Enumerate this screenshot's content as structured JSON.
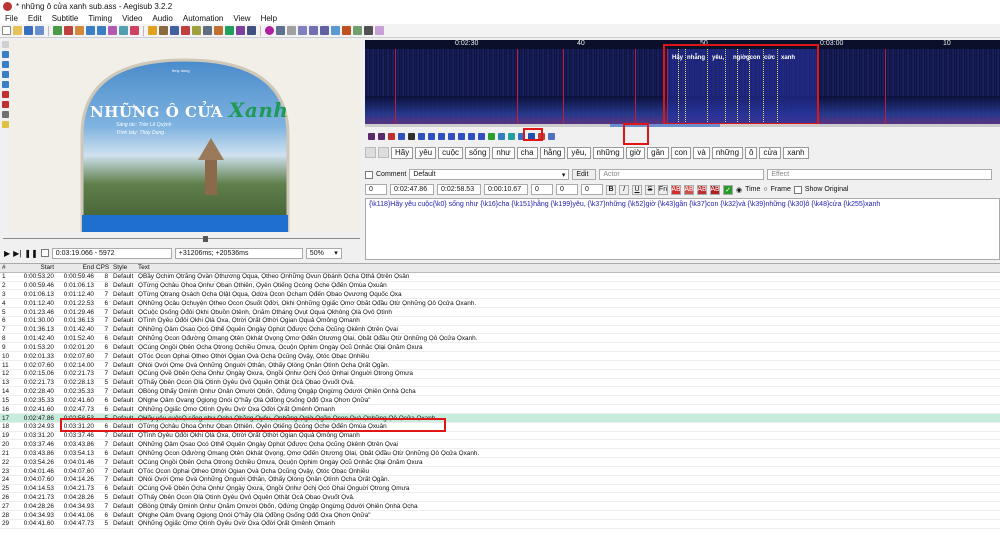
{
  "window": {
    "title": "* những ô cửa xanh sub.ass - Aegisub 3.2.2"
  },
  "menu": [
    "File",
    "Edit",
    "Subtitle",
    "Timing",
    "Video",
    "Audio",
    "Automation",
    "View",
    "Help"
  ],
  "video": {
    "title_main": "NHỮNG Ô CỬA",
    "title_accent": "Xanh",
    "composer": "Sáng tác: Trần Lê Quỳnh",
    "performer": "Trình bày: Thùy Dung",
    "logo": "thùy dung",
    "time": "0:03:19.066 - 5972",
    "offset": "+31206ms; +20536ms",
    "zoom": "50%"
  },
  "audio": {
    "ruler": [
      {
        "label": "0:02:30"
      },
      {
        "label": "40"
      },
      {
        "label": "50"
      },
      {
        "label": "0:03:00"
      },
      {
        "label": "10"
      }
    ],
    "words": [
      "Hãy",
      "nhẵng",
      "yêu,",
      "ngiờ",
      "gcon",
      "cửc",
      "xanh"
    ]
  },
  "karaoke": {
    "words": [
      "Hãy",
      "yêu",
      "cuộc",
      "sống",
      "như",
      "cha",
      "hằng",
      "yêu,",
      "những",
      "giờ",
      "gần",
      "con",
      "và",
      "những",
      "ô",
      "cửa",
      "xanh"
    ]
  },
  "edit": {
    "comment_label": "Comment",
    "style": "Default",
    "edit_label": "Edit",
    "actor_placeholder": "Actor",
    "effect_placeholder": "Effect",
    "layer": "0",
    "start": "0:02:47.86",
    "end": "0:02:58.53",
    "duration": "0:00:10.67",
    "margin_l": "0",
    "margin_r": "0",
    "margin_v": "0",
    "bold": "B",
    "italic": "I",
    "underline": "U",
    "strike": "S",
    "font": "Fn",
    "color1": "AB",
    "color2": "AB",
    "color3": "AB",
    "color4": "AB",
    "time_label": "Time",
    "frame_label": "Frame",
    "show_original": "Show Original",
    "text": "{\\k118}Hãy yêu cuộc{\\k0} sống như {\\k16}cha {\\k151}hằng {\\k199}yêu, {\\k37}những {\\k52}giờ {\\k43}gần {\\k37}con {\\k32}và {\\k39}những {\\k30}ô {\\k48}cửa {\\k255}xanh"
  },
  "grid": {
    "headers": [
      "#",
      "Start",
      "End",
      "CPS",
      "Style",
      "Text"
    ],
    "rows": [
      [
        "1",
        "0:00:53.20",
        "0:00:59.46",
        "8",
        "Default",
        "ỌBầy Ọchim Ọtrắng Ọvẫn Ọthương Ọqua, Ọtheo Ọnhững Ọvun Ọbánh Ọcha Ọthả Ọtrên Ọsân"
      ],
      [
        "2",
        "0:00:59.46",
        "0:01:06.13",
        "8",
        "Default",
        "ỌTừng Ọchâu Ọhoa Ọnhư Ọban Ọthiên, Ọyên Ọtiếng Ọcòng Ọche Ọđến Ọmùa Ọxuân"
      ],
      [
        "3",
        "0:01:06.13",
        "0:01:12.40",
        "7",
        "Default",
        "ỌTừng Ọtrang Ọsách Ọcha Ọlật Ọqua, Ọdừa Ọcon Ọchạm Ọđến Ọbao Ọvương Ọquốc Ọxa"
      ],
      [
        "4",
        "0:01:12.40",
        "0:01:22.53",
        "6",
        "Default",
        "ỌNhững Ọcâu Ọchuyện Ọtheo Ọcon Ọsuốt Ọđời, Ọkhi Ọnhững Ọgiấc Ọmơ Ọbắt Ọđầu Ọtừ Ọnhững Ọô Ọcửa Ọxanh."
      ],
      [
        "5",
        "0:01:23.46",
        "0:01:29.46",
        "7",
        "Default",
        "ỌCuộc Ọsống Ọđôi Ọkhi Ọbuồn Ọtênh, Ọnắm Ọtháng Ọvụt Ọqua Ọkhông Ọlà Ọvô Ọtình"
      ],
      [
        "6",
        "0:01:30.00",
        "0:01:36.13",
        "7",
        "Default",
        "ỌTình Ọyêu Ọđôi Ọkhi Ọlà Ọxa, Ọtrời Ọrất Ọthời Ọgian Ọquả Ọmông Ọmanh"
      ],
      [
        "7",
        "0:01:36.13",
        "0:01:42.40",
        "7",
        "Default",
        "ỌNhững Ọâm Ọsao Ọcó Ọthể Ọquên Ọngày Ọphút Ọđược Ọcha Ọcũng Ọkênh Ọtrên Ọvai"
      ],
      [
        "8",
        "0:01:42.40",
        "0:01:52.40",
        "6",
        "Default",
        "ỌNhững Ọcon Ọđường Ọmang Ọtên Ọkhát Ọvọng Ọmơ Ọđến Ọtương Ọlai, Ọbắt Ọđầu Ọtừ Ọnhững Ọô Ọcửa Ọxanh."
      ],
      [
        "9",
        "0:01:53.20",
        "0:02:01.20",
        "6",
        "Default",
        "ỌCùng Ọngồi Ọbên Ọcha Ọtrong Ọchiều Ọmưa, Ọcuộn Ọphim Ọngày Ọcũ Ọnhắc Ọlại Ọnăm Ọxưa"
      ],
      [
        "10",
        "0:02:01.33",
        "0:02:07.60",
        "7",
        "Default",
        "ỌTóc Ọcon Ọphai Ọtheo Ọthời Ọgian Ọvà Ọcha Ọcũng Ọvậy, Ọtóc Ọbạc Ọnhiều"
      ],
      [
        "11",
        "0:02:07.60",
        "0:02:14.00",
        "7",
        "Default",
        "ỌNói Ọvới Ọme Ọvà Ọnhững Ọnguời Ọthân, Ọthấy Ọlòng Ọnân Ọtình Ọcha Ọrất Ọgần."
      ],
      [
        "12",
        "0:02:15.06",
        "0:02:21.73",
        "7",
        "Default",
        "ỌCùng Ọvề Ọbên Ọcha Ọnhư Ọngày Ọxưa, Ọngồi Ọnhư Ọchị Ọcó Ọnhai Ọnguời Ọtrong Ọmưa"
      ],
      [
        "13",
        "0:02:21.73",
        "0:02:28.13",
        "5",
        "Default",
        "ỌThấy Ọbên Ọcon Ọlà Ọtình Ọyêu Ọvô Ọquên Ọthật Ọcả Ọbao Ọvuốt Ọvả."
      ],
      [
        "14",
        "0:02:28.40",
        "0:02:35.33",
        "7",
        "Default",
        "ỌBỗng Ọthấy Ọmình Ọnhư Ọnân Ọmười Ọbốn, Ọđứng Ọngập Ọngừng Ọdưới Ọhiên Ọnhà Ọcha"
      ],
      [
        "15",
        "0:02:35.33",
        "0:02:41.60",
        "6",
        "Default",
        "ỌNghe Ọâm Ọvang Ọgiọng Ọnói Ọ\"hãy Ọlà Ọđồng Ọsống Ọđổ Ọxa Ọhơn Ọnữa\""
      ],
      [
        "16",
        "0:02:41.60",
        "0:02:47.73",
        "6",
        "Default",
        "ỌNhững Ọgiấc Ọmơ Ọtình Ọyêu Ọvờ Ọxa Ọđời Ọrất Ọmênh Ọmanh"
      ],
      [
        "17",
        "0:02:47.86",
        "0:02:58.53",
        "5",
        "Default",
        "ỌHãy yêu cuộcỌ sống như Ọcha Ọhằng Ọyêu, Ọnhững Ọgiờ Ọgần Ọcon Ọvà Ọnhững Ọô Ọcửa Ọxanh"
      ],
      [
        "18",
        "0:03:24.93",
        "0:03:31.20",
        "6",
        "Default",
        "ỌTừng Ọchâu Ọhoa Ọnhư Ọban Ọthiên, Ọyên Ọtiếng Ọcòng Ọche Ọđến Ọmùa Ọxuân"
      ],
      [
        "19",
        "0:03:31.20",
        "0:03:37.46",
        "7",
        "Default",
        "ỌTình Ọyêu Ọđôi Ọkhi Ọlà Ọxa, Ọtrời Ọrất Ọthời Ọgian Ọquả Ọmông Ọmanh"
      ],
      [
        "20",
        "0:03:37.46",
        "0:03:43.86",
        "7",
        "Default",
        "ỌNhững Ọâm Ọsao Ọcó Ọthể Ọquên Ọngày Ọphút Ọđược Ọcha Ọcũng Ọkênh Ọtrên Ọvai"
      ],
      [
        "21",
        "0:03:43.86",
        "0:03:54.13",
        "6",
        "Default",
        "ỌNhững Ọcon Ọđường Ọmang Ọtên Ọkhát Ọvọng, Ọmơ Ọđến Ọtương Ọlai, Ọbắt Ọđầu Ọtừ Ọnhững Ọô Ọcửa Ọxanh."
      ],
      [
        "22",
        "0:03:54.26",
        "0:04:01.46",
        "7",
        "Default",
        "ỌCùng Ọngồi Ọbên Ọcha Ọtrong Ọchiều Ọmưa, Ọcuộn Ọphim Ọngày Ọcũ Ọnhắc Ọlại Ọnăm Ọxưa"
      ],
      [
        "23",
        "0:04:01.46",
        "0:04:07.60",
        "7",
        "Default",
        "ỌTóc Ọcon Ọphai Ọtheo Ọthời Ọgian Ọvà Ọcha Ọcũng Ọvậy, Ọtóc Ọbạc Ọnhiều"
      ],
      [
        "24",
        "0:04:07.60",
        "0:04:14.26",
        "7",
        "Default",
        "ỌNói Ọvới Ọme Ọvà Ọnhững Ọnguời Ọthân, Ọthấy Ọlòng Ọnân Ọtình Ọcha Ọrất Ọgần."
      ],
      [
        "25",
        "0:04:14.53",
        "0:04:21.73",
        "6",
        "Default",
        "ỌCùng Ọvề Ọbên Ọcha Ọnhư Ọngày Ọxưa, Ọngồi Ọnhư Ọchị Ọcó Ọhai Ọnguời Ọtrong Ọmưa"
      ],
      [
        "26",
        "0:04:21.73",
        "0:04:28.26",
        "5",
        "Default",
        "ỌThấy Ọbên Ọcon Ọlà Ọtình Ọyêu Ọvô Ọquên Ọthật Ọcả Ọbao Ọvuốt Ọvả."
      ],
      [
        "27",
        "0:04:28.26",
        "0:04:34.93",
        "7",
        "Default",
        "ỌBỗng Ọthấy Ọmình Ọnhư Ọnăm Ọmười Ọbốn, Ọđứng Ọngập Ọngừng Ọdưới Ọhiên Ọnhà Ọcha"
      ],
      [
        "28",
        "0:04:34.93",
        "0:04:41.06",
        "6",
        "Default",
        "ỌNghe Ọâm Ọvang Ọgiọng Ọnói Ọ\"hãy Ọlà Ọđồng Ọsống Ọđổ Ọxa Ọhơn Ọnữa\""
      ],
      [
        "29",
        "0:04:41.60",
        "0:04:47.73",
        "5",
        "Default",
        "ỌNhững Ọgiấc Ọmơ Ọtình Ọyêu Ọvờ Ọxa Ọđời Ọrất Ọmênh Ọmanh"
      ]
    ]
  }
}
